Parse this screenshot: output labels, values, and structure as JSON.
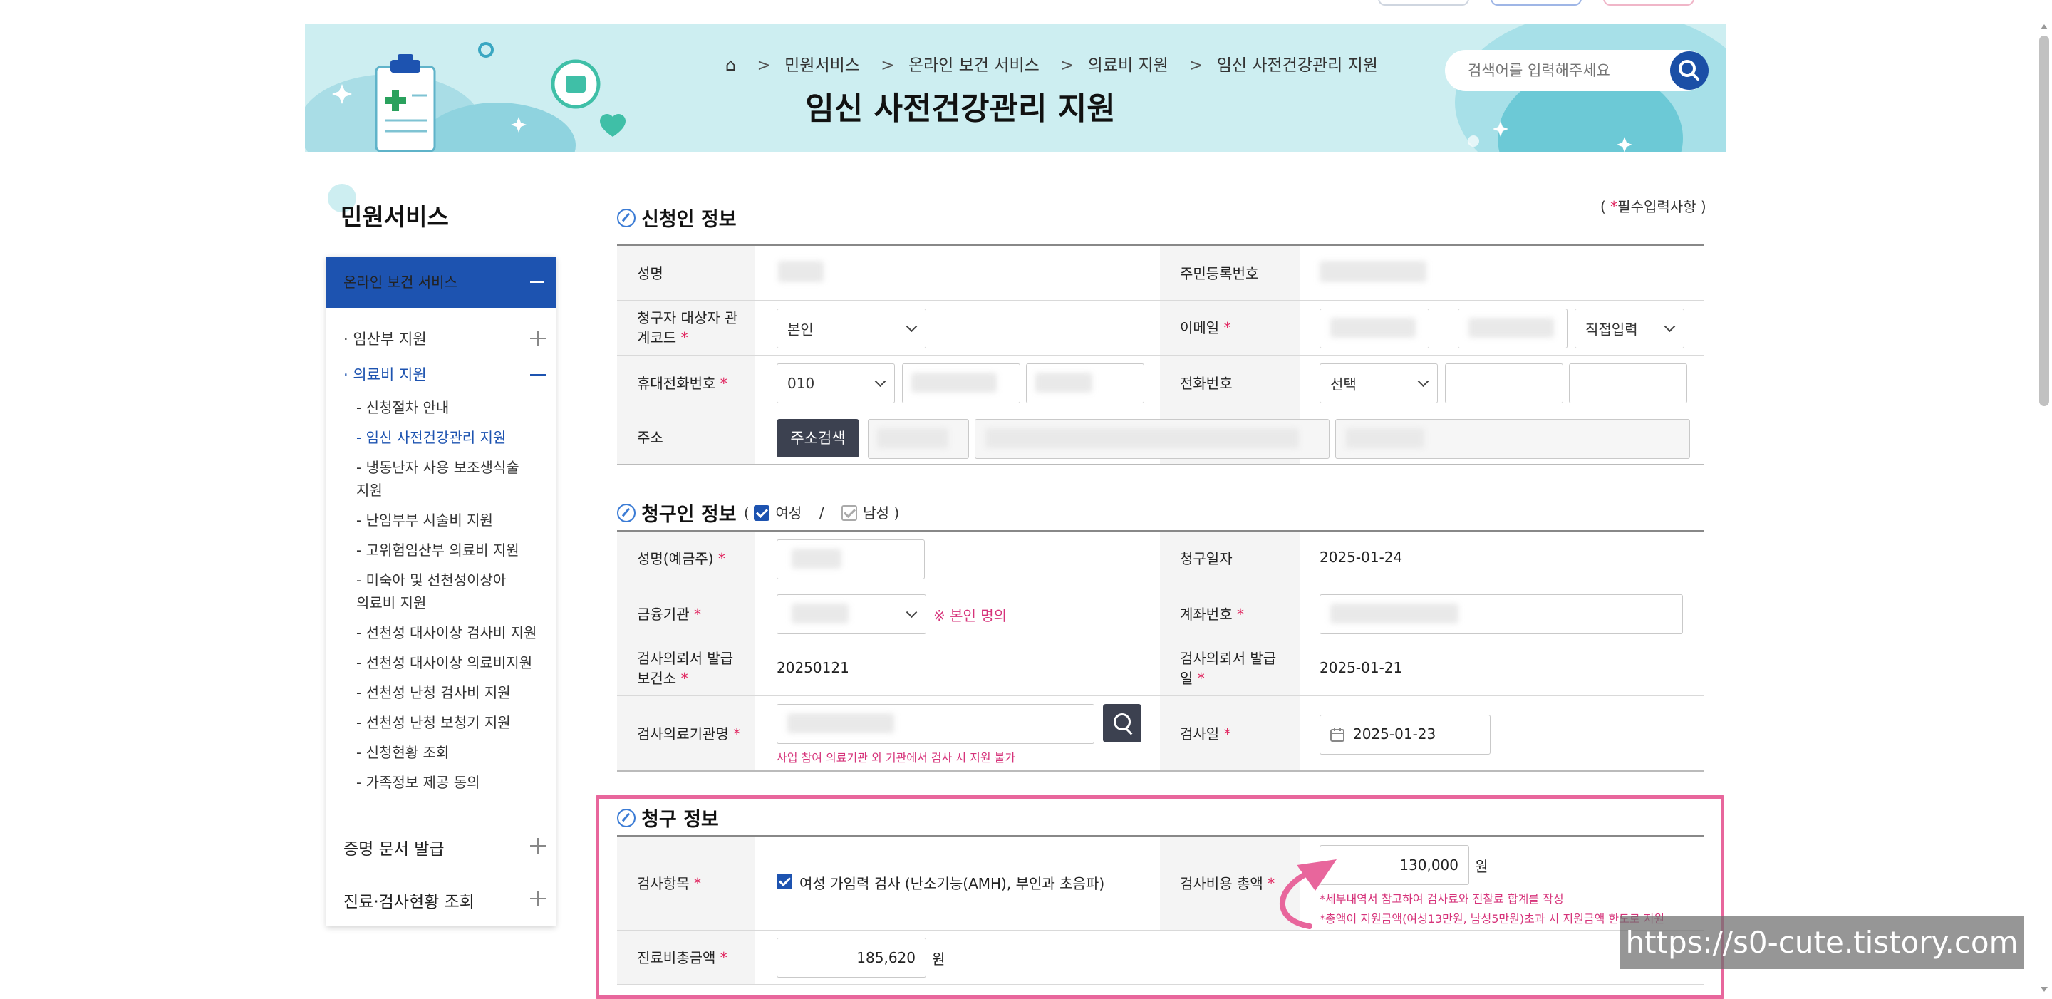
{
  "breadcrumb": {
    "items": [
      "민원서비스",
      "온라인 보건 서비스",
      "의료비 지원",
      "임신 사전건강관리 지원"
    ],
    "sep": ">"
  },
  "page_title": "임신 사전건강관리 지원",
  "search": {
    "placeholder": "검색어를 입력해주세요"
  },
  "sidebar": {
    "title": "민원서비스",
    "active_group": "온라인 보건 서비스",
    "items": [
      {
        "label": "임산부 지원",
        "active": false
      },
      {
        "label": "의료비 지원",
        "active": true
      }
    ],
    "subitems": [
      "신청절차 안내",
      "임신 사전건강관리 지원",
      "냉동난자 사용 보조생식술 지원",
      "난임부부 시술비 지원",
      "고위험임산부 의료비 지원",
      "미숙아 및 선천성이상아 의료비 지원",
      "선천성 대사이상 검사비 지원",
      "선천성 대사이상 의료비지원",
      "선천성 난청 검사비 지원",
      "선천성 난청 보청기 지원",
      "신청현황 조회",
      "가족정보 제공 동의"
    ],
    "bottom_groups": [
      "증명 문서 발급",
      "진료·검사현황 조회"
    ]
  },
  "form": {
    "required_note_pre": "( ",
    "required_note_star": "*",
    "required_note_post": "필수입력사항 )",
    "applicant": {
      "title": "신청인 정보",
      "name_label": "성명",
      "rrn_label": "주민등록번호",
      "relation_label": "청구자 대상자 관계코드",
      "relation_value": "본인",
      "email_label": "이메일",
      "email_domain_select": "직접입력",
      "mobile_label": "휴대전화번호",
      "mobile_prefix": "010",
      "phone_label": "전화번호",
      "phone_select": "선택",
      "address_label": "주소",
      "address_button": "주소검색"
    },
    "claimant": {
      "title": "청구인 정보",
      "gender_open": "(",
      "female": "여성",
      "slash": "/",
      "male": "남성",
      "gender_close": ")",
      "name_label": "성명(예금주)",
      "claim_date_label": "청구일자",
      "claim_date": "2025-01-24",
      "bank_label": "금융기관",
      "bank_note": "※ 본인 명의",
      "account_label": "계좌번호",
      "issuer_label": "검사의뢰서 발급 보건소",
      "issuer_value": "20250121",
      "issue_date_label": "검사의뢰서 발급일",
      "issue_date": "2025-01-21",
      "hospital_label": "검사의료기관명",
      "hospital_note": "사업 참여 의료기관 외 기관에서 검사 시 지원 불가",
      "test_date_label": "검사일",
      "test_date": "2025-01-23"
    },
    "claim": {
      "title": "청구 정보",
      "item_label": "검사항목",
      "item_value": "여성 가임력 검사 (난소기능(AMH), 부인과 초음파)",
      "cost_label": "검사비용 총액",
      "cost_value": "130,000",
      "won": "원",
      "cost_note1": "*세부내역서 참고하여 검사료와 진찰료 합계를 작성",
      "cost_note2": "*총액이 지원금액(여성13만원, 남성5만원)초과 시 지원금액 한도로 지원",
      "total_label": "진료비총금액",
      "total_value": "185,620"
    }
  },
  "watermark": "https://s0-cute.tistory.com",
  "colors": {
    "brand_blue": "#1d53b0",
    "highlight_pink": "#e8669c",
    "banner_bg": "#cdeef1"
  }
}
